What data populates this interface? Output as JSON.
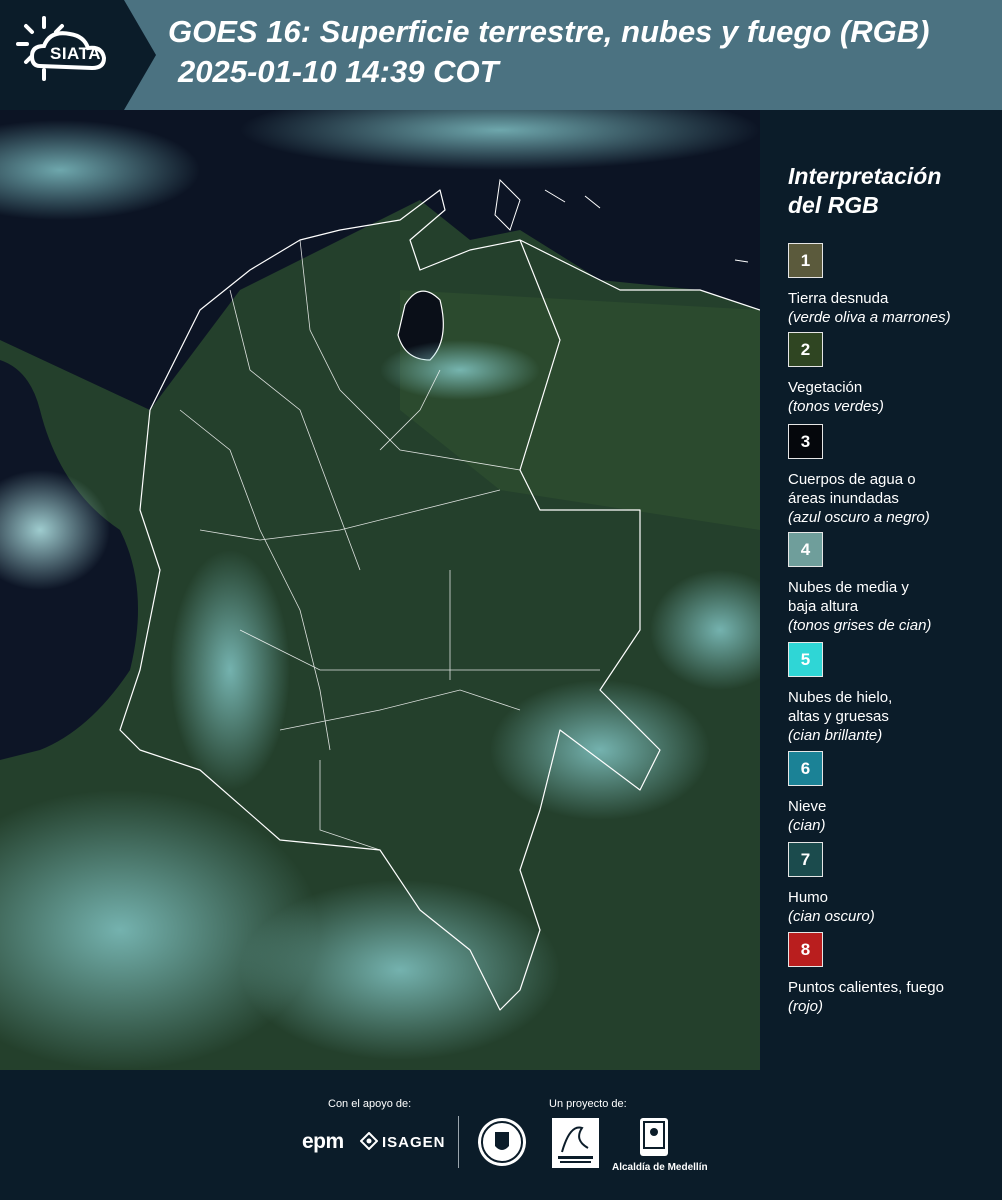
{
  "header": {
    "logo_text": "SIATA",
    "title_line1": "GOES 16: Superficie terrestre, nubes y fuego (RGB)",
    "title_line2": "2025-01-10 14:39 COT"
  },
  "legend": {
    "title_line1": "Interpretación",
    "title_line2": "del RGB",
    "items": [
      {
        "num": "1",
        "color": "#5b5a3c",
        "label": "Tierra desnuda",
        "label2": "",
        "sub": "(verde oliva a marrones)"
      },
      {
        "num": "2",
        "color": "#2f4522",
        "label": "Vegetación",
        "label2": "",
        "sub": "(tonos verdes)"
      },
      {
        "num": "3",
        "color": "#05070c",
        "label": "Cuerpos de agua o",
        "label2": "áreas inundadas",
        "sub": "(azul oscuro a negro)"
      },
      {
        "num": "4",
        "color": "#6f9e9b",
        "label": "Nubes de media y",
        "label2": "baja altura",
        "sub": "(tonos grises de cian)"
      },
      {
        "num": "5",
        "color": "#2fd6d6",
        "label": "Nubes de hielo,",
        "label2": "altas y gruesas",
        "sub": "(cian brillante)"
      },
      {
        "num": "6",
        "color": "#1b8296",
        "label": "Nieve",
        "label2": "",
        "sub": "(cian)"
      },
      {
        "num": "7",
        "color": "#1b4b4d",
        "label": "Humo",
        "label2": "",
        "sub": "(cian oscuro)"
      },
      {
        "num": "8",
        "color": "#b91e1e",
        "label": "Puntos calientes, fuego",
        "label2": "",
        "sub": "(rojo)"
      }
    ]
  },
  "footer": {
    "support_caption": "Con el apoyo de:",
    "project_caption": "Un proyecto de:",
    "epm": "epm",
    "isagen": "ISAGEN",
    "alcaldia": "Alcaldía de Medellín"
  }
}
